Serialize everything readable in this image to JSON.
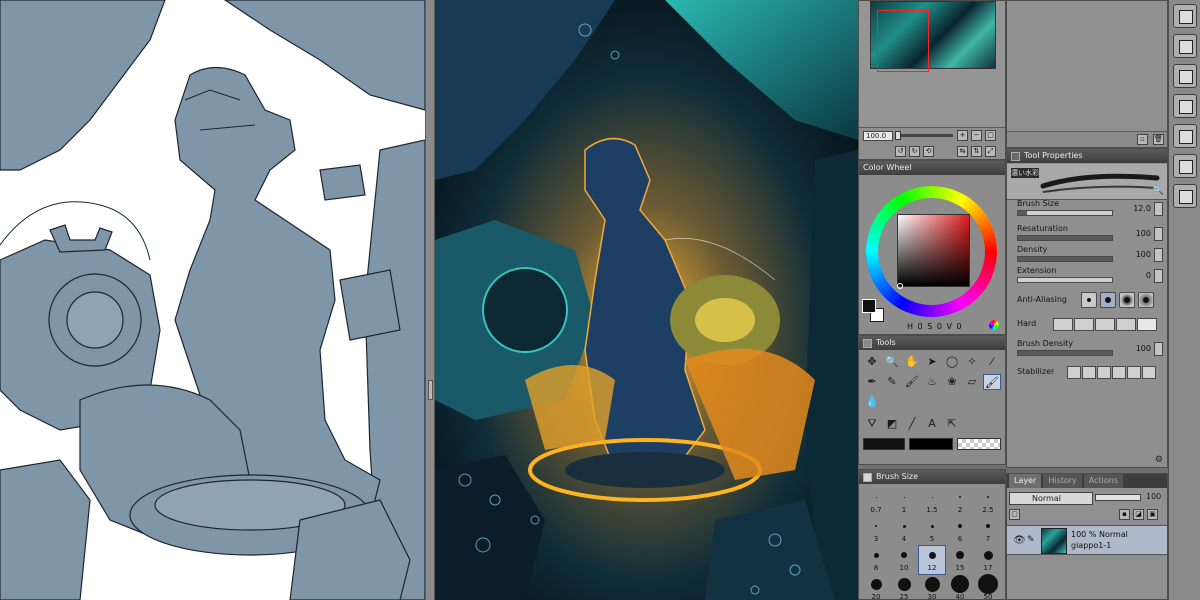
{
  "navigator": {
    "zoom": "100.0"
  },
  "color_panel": {
    "title": "Color Wheel",
    "hsv_readout": "H 0  S 0  V 0",
    "selected_hue": "#e31d1d"
  },
  "tools_panel": {
    "title": "Tools"
  },
  "brush_size_panel": {
    "title": "Brush Size",
    "sizes": [
      {
        "label": "0.7",
        "d": 1
      },
      {
        "label": "1",
        "d": 1
      },
      {
        "label": "1.5",
        "d": 1
      },
      {
        "label": "2",
        "d": 2
      },
      {
        "label": "2.5",
        "d": 2
      },
      {
        "label": "3",
        "d": 2
      },
      {
        "label": "4",
        "d": 3
      },
      {
        "label": "5",
        "d": 3
      },
      {
        "label": "6",
        "d": 4
      },
      {
        "label": "7",
        "d": 4
      },
      {
        "label": "8",
        "d": 5
      },
      {
        "label": "10",
        "d": 6
      },
      {
        "label": "12",
        "d": 7
      },
      {
        "label": "15",
        "d": 8
      },
      {
        "label": "17",
        "d": 9
      },
      {
        "label": "20",
        "d": 11
      },
      {
        "label": "25",
        "d": 13
      },
      {
        "label": "30",
        "d": 15
      },
      {
        "label": "40",
        "d": 18
      },
      {
        "label": "50",
        "d": 20
      }
    ],
    "selected": "12"
  },
  "tool_properties": {
    "title": "Tool Properties",
    "brush_name": "濃い水彩",
    "brush_size_label": "Brush Size",
    "brush_size_value": "12.0",
    "resaturation_label": "Resaturation",
    "resaturation_value": "100",
    "density_label": "Density",
    "density_value": "100",
    "extension_label": "Extension",
    "extension_value": "0",
    "anti_aliasing_label": "Anti-Aliasing",
    "hard_label": "Hard",
    "brush_density_label": "Brush Density",
    "brush_density_value": "100",
    "stabilizer_label": "Stabilizer"
  },
  "layer_panel": {
    "tabs": [
      "Layer",
      "History",
      "Actions"
    ],
    "blend_mode": "Normal",
    "opacity": "100",
    "layer_meta": "100 % Normal",
    "layer_name": "giappo1-1"
  }
}
